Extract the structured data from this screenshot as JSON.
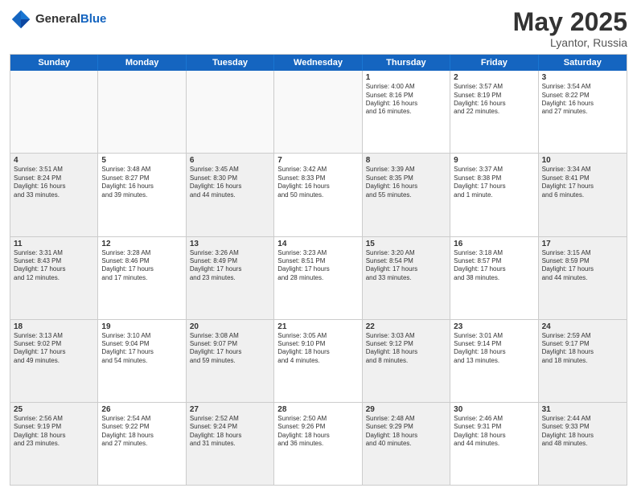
{
  "header": {
    "logo_general": "General",
    "logo_blue": "Blue",
    "title": "May 2025",
    "location": "Lyantor, Russia"
  },
  "days_of_week": [
    "Sunday",
    "Monday",
    "Tuesday",
    "Wednesday",
    "Thursday",
    "Friday",
    "Saturday"
  ],
  "rows": [
    [
      {
        "day": "",
        "text": "",
        "empty": true
      },
      {
        "day": "",
        "text": "",
        "empty": true
      },
      {
        "day": "",
        "text": "",
        "empty": true
      },
      {
        "day": "",
        "text": "",
        "empty": true
      },
      {
        "day": "1",
        "text": "Sunrise: 4:00 AM\nSunset: 8:16 PM\nDaylight: 16 hours\nand 16 minutes."
      },
      {
        "day": "2",
        "text": "Sunrise: 3:57 AM\nSunset: 8:19 PM\nDaylight: 16 hours\nand 22 minutes."
      },
      {
        "day": "3",
        "text": "Sunrise: 3:54 AM\nSunset: 8:22 PM\nDaylight: 16 hours\nand 27 minutes."
      }
    ],
    [
      {
        "day": "4",
        "text": "Sunrise: 3:51 AM\nSunset: 8:24 PM\nDaylight: 16 hours\nand 33 minutes.",
        "shaded": true
      },
      {
        "day": "5",
        "text": "Sunrise: 3:48 AM\nSunset: 8:27 PM\nDaylight: 16 hours\nand 39 minutes."
      },
      {
        "day": "6",
        "text": "Sunrise: 3:45 AM\nSunset: 8:30 PM\nDaylight: 16 hours\nand 44 minutes.",
        "shaded": true
      },
      {
        "day": "7",
        "text": "Sunrise: 3:42 AM\nSunset: 8:33 PM\nDaylight: 16 hours\nand 50 minutes."
      },
      {
        "day": "8",
        "text": "Sunrise: 3:39 AM\nSunset: 8:35 PM\nDaylight: 16 hours\nand 55 minutes.",
        "shaded": true
      },
      {
        "day": "9",
        "text": "Sunrise: 3:37 AM\nSunset: 8:38 PM\nDaylight: 17 hours\nand 1 minute."
      },
      {
        "day": "10",
        "text": "Sunrise: 3:34 AM\nSunset: 8:41 PM\nDaylight: 17 hours\nand 6 minutes.",
        "shaded": true
      }
    ],
    [
      {
        "day": "11",
        "text": "Sunrise: 3:31 AM\nSunset: 8:43 PM\nDaylight: 17 hours\nand 12 minutes.",
        "shaded": true
      },
      {
        "day": "12",
        "text": "Sunrise: 3:28 AM\nSunset: 8:46 PM\nDaylight: 17 hours\nand 17 minutes."
      },
      {
        "day": "13",
        "text": "Sunrise: 3:26 AM\nSunset: 8:49 PM\nDaylight: 17 hours\nand 23 minutes.",
        "shaded": true
      },
      {
        "day": "14",
        "text": "Sunrise: 3:23 AM\nSunset: 8:51 PM\nDaylight: 17 hours\nand 28 minutes."
      },
      {
        "day": "15",
        "text": "Sunrise: 3:20 AM\nSunset: 8:54 PM\nDaylight: 17 hours\nand 33 minutes.",
        "shaded": true
      },
      {
        "day": "16",
        "text": "Sunrise: 3:18 AM\nSunset: 8:57 PM\nDaylight: 17 hours\nand 38 minutes."
      },
      {
        "day": "17",
        "text": "Sunrise: 3:15 AM\nSunset: 8:59 PM\nDaylight: 17 hours\nand 44 minutes.",
        "shaded": true
      }
    ],
    [
      {
        "day": "18",
        "text": "Sunrise: 3:13 AM\nSunset: 9:02 PM\nDaylight: 17 hours\nand 49 minutes.",
        "shaded": true
      },
      {
        "day": "19",
        "text": "Sunrise: 3:10 AM\nSunset: 9:04 PM\nDaylight: 17 hours\nand 54 minutes."
      },
      {
        "day": "20",
        "text": "Sunrise: 3:08 AM\nSunset: 9:07 PM\nDaylight: 17 hours\nand 59 minutes.",
        "shaded": true
      },
      {
        "day": "21",
        "text": "Sunrise: 3:05 AM\nSunset: 9:10 PM\nDaylight: 18 hours\nand 4 minutes."
      },
      {
        "day": "22",
        "text": "Sunrise: 3:03 AM\nSunset: 9:12 PM\nDaylight: 18 hours\nand 8 minutes.",
        "shaded": true
      },
      {
        "day": "23",
        "text": "Sunrise: 3:01 AM\nSunset: 9:14 PM\nDaylight: 18 hours\nand 13 minutes."
      },
      {
        "day": "24",
        "text": "Sunrise: 2:59 AM\nSunset: 9:17 PM\nDaylight: 18 hours\nand 18 minutes.",
        "shaded": true
      }
    ],
    [
      {
        "day": "25",
        "text": "Sunrise: 2:56 AM\nSunset: 9:19 PM\nDaylight: 18 hours\nand 23 minutes.",
        "shaded": true
      },
      {
        "day": "26",
        "text": "Sunrise: 2:54 AM\nSunset: 9:22 PM\nDaylight: 18 hours\nand 27 minutes."
      },
      {
        "day": "27",
        "text": "Sunrise: 2:52 AM\nSunset: 9:24 PM\nDaylight: 18 hours\nand 31 minutes.",
        "shaded": true
      },
      {
        "day": "28",
        "text": "Sunrise: 2:50 AM\nSunset: 9:26 PM\nDaylight: 18 hours\nand 36 minutes."
      },
      {
        "day": "29",
        "text": "Sunrise: 2:48 AM\nSunset: 9:29 PM\nDaylight: 18 hours\nand 40 minutes.",
        "shaded": true
      },
      {
        "day": "30",
        "text": "Sunrise: 2:46 AM\nSunset: 9:31 PM\nDaylight: 18 hours\nand 44 minutes."
      },
      {
        "day": "31",
        "text": "Sunrise: 2:44 AM\nSunset: 9:33 PM\nDaylight: 18 hours\nand 48 minutes.",
        "shaded": true
      }
    ]
  ]
}
